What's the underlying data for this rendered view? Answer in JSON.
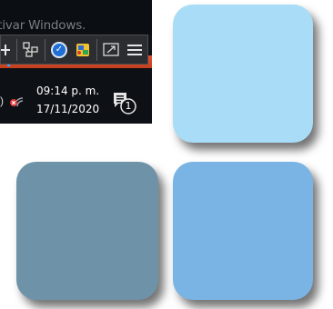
{
  "taskbar": {
    "watermark": "ctivar Windows.",
    "clock": {
      "time": "09:14 p. m.",
      "date": "17/11/2020"
    },
    "notification_count": "1",
    "toolbar_icons": [
      "add-icon",
      "network-drives-icon",
      "blue-circle-app-icon",
      "color-app-icon",
      "screen-expand-icon",
      "hamburger-menu-icon"
    ],
    "tray_icons": [
      "speaker-icon",
      "network-disconnected-icon",
      "notification-center-icon"
    ],
    "colors": {
      "taskbar_bg": "#101418",
      "orange_bar": "#d4482a",
      "clock_text": "#ffffff"
    }
  },
  "tiles": [
    {
      "name": "light-blue-tile",
      "color": "#a9dcf7"
    },
    {
      "name": "slate-blue-tile",
      "color": "#6e93a8"
    },
    {
      "name": "medium-blue-tile",
      "color": "#79b4e4"
    }
  ]
}
